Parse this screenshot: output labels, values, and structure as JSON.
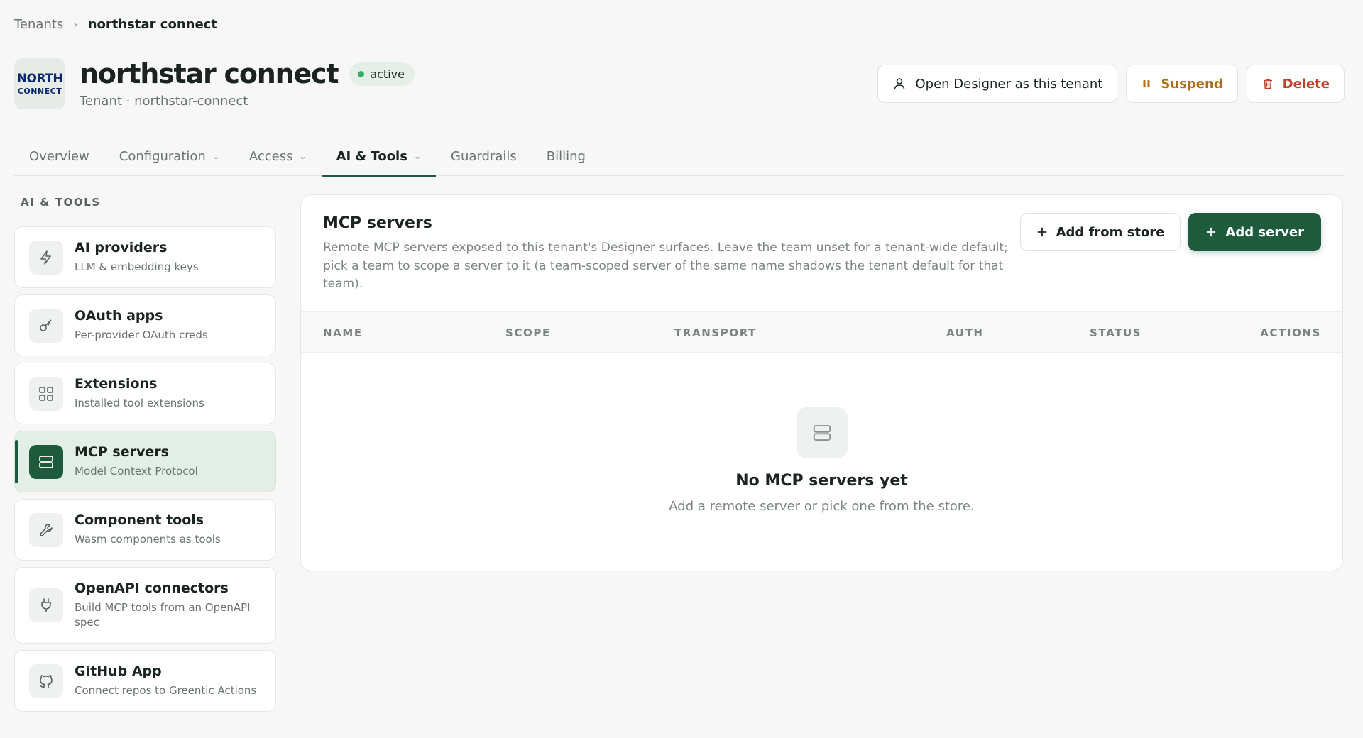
{
  "breadcrumb": {
    "parent": "Tenants",
    "current": "northstar connect"
  },
  "logo": {
    "top": "NORTH",
    "bottom": "CONNECT"
  },
  "tenant": {
    "name": "northstar connect",
    "status": "active",
    "subtitle": "Tenant · northstar-connect"
  },
  "actions": {
    "open_designer": "Open Designer as this tenant",
    "suspend": "Suspend",
    "delete": "Delete"
  },
  "tabs": [
    {
      "label": "Overview"
    },
    {
      "label": "Configuration"
    },
    {
      "label": "Access"
    },
    {
      "label": "AI & Tools"
    },
    {
      "label": "Guardrails"
    },
    {
      "label": "Billing"
    }
  ],
  "sidebar": {
    "heading": "AI & TOOLS",
    "items": [
      {
        "title": "AI providers",
        "desc": "LLM & embedding keys",
        "icon": "lightning-icon"
      },
      {
        "title": "OAuth apps",
        "desc": "Per-provider OAuth creds",
        "icon": "key-icon"
      },
      {
        "title": "Extensions",
        "desc": "Installed tool extensions",
        "icon": "grid-icon"
      },
      {
        "title": "MCP servers",
        "desc": "Model Context Protocol",
        "icon": "server-icon"
      },
      {
        "title": "Component tools",
        "desc": "Wasm components as tools",
        "icon": "wrench-icon"
      },
      {
        "title": "OpenAPI connectors",
        "desc": "Build MCP tools from an OpenAPI spec",
        "icon": "plug-icon"
      },
      {
        "title": "GitHub App",
        "desc": "Connect repos to Greentic Actions",
        "icon": "github-icon"
      }
    ]
  },
  "panel": {
    "title": "MCP servers",
    "description": "Remote MCP servers exposed to this tenant's Designer surfaces. Leave the team unset for a tenant-wide default; pick a team to scope a server to it (a team-scoped server of the same name shadows the tenant default for that team).",
    "add_from_store": "Add from store",
    "add_server": "Add server",
    "columns": [
      "NAME",
      "SCOPE",
      "TRANSPORT",
      "AUTH",
      "STATUS",
      "ACTIONS"
    ],
    "empty_title": "No MCP servers yet",
    "empty_subtitle": "Add a remote server or pick one from the store."
  },
  "colors": {
    "accent": "#1e5b3c",
    "status_active": "#2fae64",
    "suspend": "#b06d10",
    "delete": "#c5402a"
  }
}
